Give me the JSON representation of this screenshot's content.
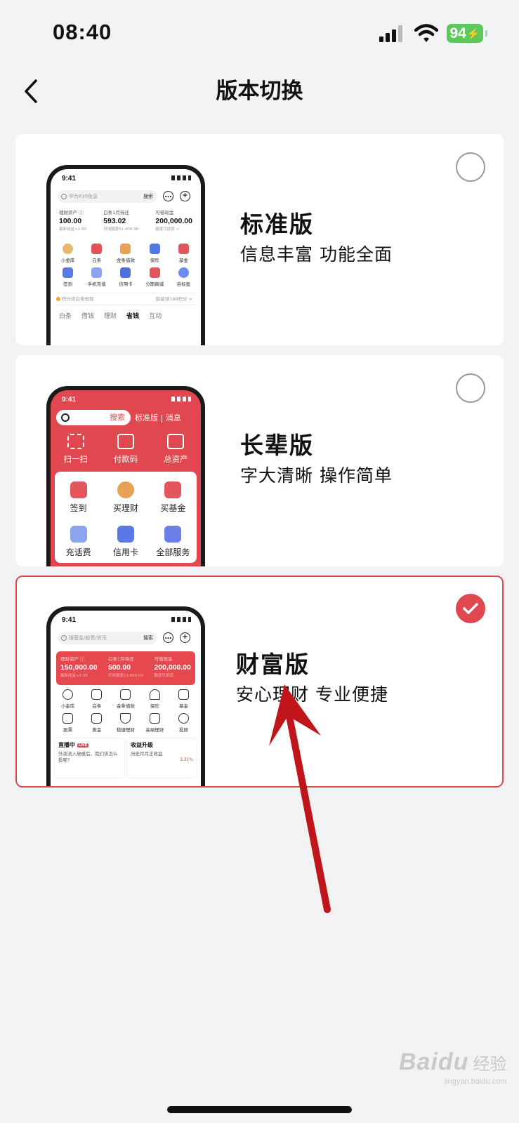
{
  "status_bar": {
    "time": "08:40",
    "battery": "94"
  },
  "header": {
    "title": "版本切换"
  },
  "options": [
    {
      "title": "标准版",
      "desc": "信息丰富 功能全面",
      "selected": false,
      "preview": {
        "time": "9:41",
        "search_placeholder": "华为P30免息",
        "search_button": "搜索",
        "assets": [
          {
            "label": "理财资产 ⓘ",
            "value": "100.00",
            "note": "最新收益+2.00"
          },
          {
            "label": "白条1月待还",
            "value": "593.02",
            "note": "可用额度51,409.98"
          },
          {
            "label": "可借现金",
            "value": "200,000.00",
            "note": "额度可提现 >"
          }
        ],
        "grid": [
          "小金库",
          "白条",
          "金条借款",
          "保险",
          "基金",
          "签到",
          "手机充值",
          "信用卡",
          "分期商城",
          "自标盈"
        ],
        "banner_left": "积分还白条规现",
        "banner_right": "链接领188积分 >",
        "tabs": [
          "白条",
          "借钱",
          "理财",
          "省钱",
          "互动"
        ]
      }
    },
    {
      "title": "长辈版",
      "desc": "字大清晰 操作简单",
      "selected": false,
      "preview": {
        "time": "9:41",
        "search_button": "搜索",
        "top_right": "标准版 | 消息",
        "quick": [
          "扫一扫",
          "付款码",
          "总资产"
        ],
        "grid": [
          "签到",
          "买理财",
          "买基金",
          "充话费",
          "信用卡",
          "全部服务"
        ]
      }
    },
    {
      "title": "财富版",
      "desc": "安心理财 专业便捷",
      "selected": true,
      "preview": {
        "time": "9:41",
        "search_placeholder": "搜基金/股票/资讯",
        "search_button": "搜索",
        "assets": [
          {
            "label": "理财资产 ⓘ",
            "value": "150,000.00",
            "note": "最新收益+2.00"
          },
          {
            "label": "白条1月待还",
            "value": "500.00",
            "note": "可用额度12,000.00"
          },
          {
            "label": "可借现金",
            "value": "200,000.00",
            "note": "额度可提现"
          }
        ],
        "grid": [
          "小金库",
          "白条",
          "金条借款",
          "保险",
          "基金",
          "股票",
          "黄金",
          "稳健理财",
          "高端理财",
          "投顾"
        ],
        "live_title": "直播中",
        "live_text": "外资流入放缓后，我们该怎么投呢?",
        "upgrade_title": "收益升级",
        "upgrade_text": "历史月月正收益",
        "upgrade_rate": "3.31%"
      }
    }
  ],
  "watermark": {
    "logo": "Baidu",
    "sub": "经验",
    "url": "jingyan.baidu.com"
  },
  "colors": {
    "accent": "#e0474e",
    "background": "#f3f3f5",
    "battery": "#5fc85c"
  }
}
